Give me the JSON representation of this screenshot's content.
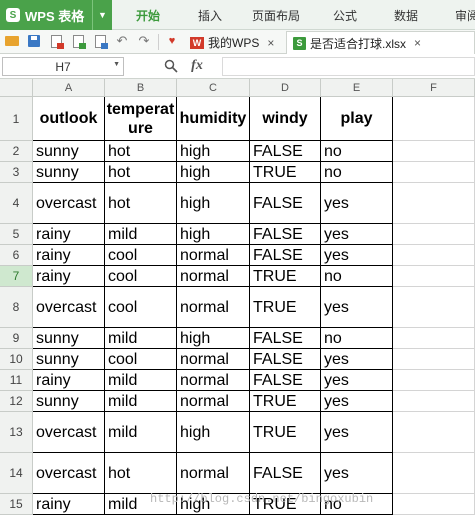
{
  "app": {
    "title": "WPS 表格",
    "logo": "S"
  },
  "menu": {
    "tabs": [
      {
        "label": "开始",
        "active": true
      },
      {
        "label": "插入"
      },
      {
        "label": "页面布局"
      },
      {
        "label": "公式"
      },
      {
        "label": "数据"
      },
      {
        "label": "审阅"
      }
    ]
  },
  "toolbar": {
    "icons": [
      "open-folder-icon",
      "save-icon",
      "export-pdf-icon",
      "print-icon",
      "print-preview-icon",
      "undo-icon",
      "redo-icon",
      "favorite-icon"
    ],
    "doc_tabs": [
      {
        "label": "我的WPS",
        "mark": "W",
        "close": "×"
      },
      {
        "label": "是否适合打球.xlsx",
        "mark": "S",
        "close": "×",
        "active": true
      }
    ]
  },
  "formula_bar": {
    "cell_ref": "H7",
    "fx_label": "fx",
    "value": ""
  },
  "grid": {
    "columns": [
      "A",
      "B",
      "C",
      "D",
      "E",
      "F"
    ],
    "header_row": [
      "outlook",
      "temperature",
      "humidity",
      "windy",
      "play"
    ],
    "rows": [
      [
        "sunny",
        "hot",
        "high",
        "FALSE",
        "no"
      ],
      [
        "sunny",
        "hot",
        "high",
        "TRUE",
        "no"
      ],
      [
        "overcast",
        "hot",
        "high",
        "FALSE",
        "yes"
      ],
      [
        "rainy",
        "mild",
        "high",
        "FALSE",
        "yes"
      ],
      [
        "rainy",
        "cool",
        "normal",
        "FALSE",
        "yes"
      ],
      [
        "rainy",
        "cool",
        "normal",
        "TRUE",
        "no"
      ],
      [
        "overcast",
        "cool",
        "normal",
        "TRUE",
        "yes"
      ],
      [
        "sunny",
        "mild",
        "high",
        "FALSE",
        "no"
      ],
      [
        "sunny",
        "cool",
        "normal",
        "FALSE",
        "yes"
      ],
      [
        "rainy",
        "mild",
        "normal",
        "FALSE",
        "yes"
      ],
      [
        "sunny",
        "mild",
        "normal",
        "TRUE",
        "yes"
      ],
      [
        "overcast",
        "mild",
        "high",
        "TRUE",
        "yes"
      ],
      [
        "overcast",
        "hot",
        "normal",
        "FALSE",
        "yes"
      ],
      [
        "rainy",
        "mild",
        "high",
        "TRUE",
        "no"
      ]
    ],
    "row_numbers": [
      "1",
      "2",
      "3",
      "4",
      "5",
      "6",
      "7",
      "8",
      "9",
      "10",
      "11",
      "12",
      "13",
      "14",
      "15"
    ],
    "selected_row": "7"
  },
  "watermark": "http://blog.csdn.net/bingoxubin",
  "colors": {
    "brand": "#4aa24a",
    "active_tab": "#3c9a3c",
    "selected_row_header": "#cfe8cf"
  }
}
